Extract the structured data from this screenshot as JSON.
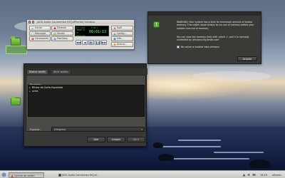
{
  "jack": {
    "title": "JACK Audio Connection Kit [ofFranfa] Iniciado.",
    "buttons": {
      "start": "Iniciar",
      "stop": "Detener",
      "messages": "Mensajes",
      "session": "Sesión",
      "connections": "Conexiones",
      "patchbay": "Patchbay",
      "quit": "Salir",
      "setup": "Config...",
      "info": "Info...",
      "about": "Acerca..."
    },
    "lcd": {
      "status": "Iniciado",
      "dsp": "0.00 %",
      "rate": "48000 Hz",
      "rt": "RT",
      "time": "00:01:13",
      "state": "Detenido"
    }
  },
  "warning": {
    "icon_letter": "!",
    "paragraph1": "WARNING: Your system has a limit for maximum amount of locked memory. This might cause Ardour to run out of memory before your system runs out of memory.",
    "paragraph2": "You can view the memory limit with 'ulimit -l', and it is normally controlled by /etc/security/limits.conf",
    "checkbox_label": "No volver a mostrar esta ventana",
    "accept_label": "Aceptar"
  },
  "session": {
    "tabs": [
      "Nueva sesión",
      "Abrir sesión"
    ],
    "recent_label": "Recientes",
    "recent_items": [
      "Ritmo de Gallo-Española",
      "unex"
    ],
    "explore_label": "Explorar:",
    "explore_value": "(Ninguno)",
    "buttons": {
      "quit": "Salir",
      "clear": "Limpiar",
      "open": "Abrir"
    }
  },
  "taskbar": {
    "tasks": [
      "Control de sesión",
      "JACK Audio Connection Kit [of..."
    ],
    "clock": "18:16",
    "user": "alfranlo"
  },
  "colors": {
    "warn_icon_green": "#5bb431",
    "lcd_green": "#36d13c",
    "stop_red": "#c0392b"
  }
}
